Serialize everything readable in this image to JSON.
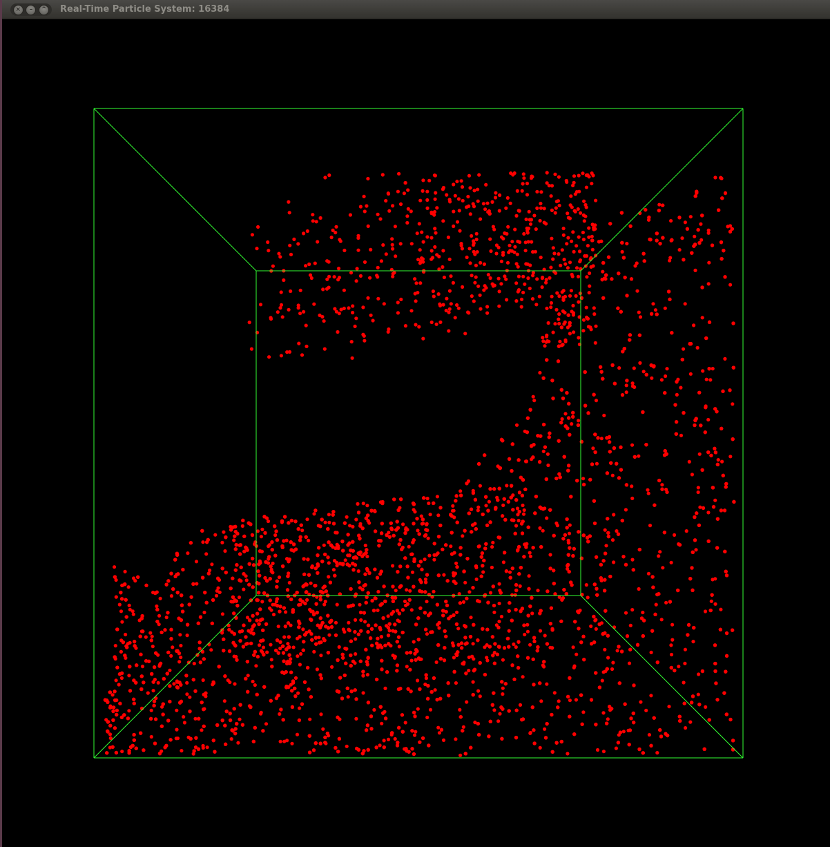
{
  "window": {
    "title": "Real-Time Particle System: 16384",
    "controls": {
      "close_icon": "close-icon",
      "minimize_icon": "minimize-icon",
      "maximize_icon": "maximize-icon",
      "close_glyph": "×",
      "minimize_glyph": "–",
      "maximize_glyph": "^"
    }
  },
  "scene": {
    "background_color": "#000000",
    "bounding_box_color": "#33ff33",
    "particle_color": "#ff0000",
    "description_icon": "particle-fluid-render"
  }
}
